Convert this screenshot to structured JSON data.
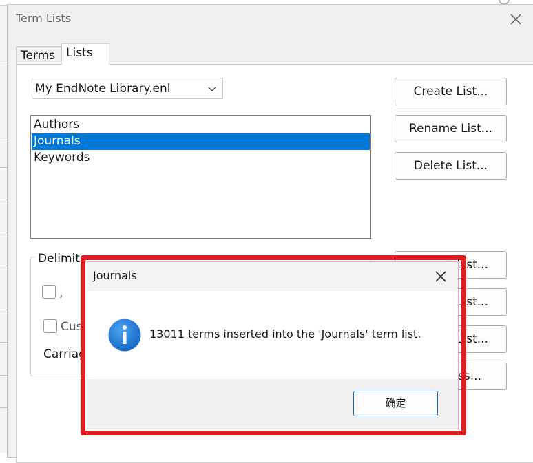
{
  "dialog": {
    "title": "Term Lists",
    "tabs": [
      {
        "label": "Terms",
        "active": false
      },
      {
        "label": "Lists",
        "active": true
      }
    ],
    "library_select": {
      "value": "My EndNote Library.enl"
    },
    "lists": [
      {
        "label": "Authors",
        "selected": false
      },
      {
        "label": "Journals",
        "selected": true
      },
      {
        "label": "Keywords",
        "selected": false
      }
    ],
    "buttons": {
      "create": "Create List...",
      "rename": "Rename List...",
      "delete": "Delete List...",
      "partial_1": "List...",
      "partial_2": "List...",
      "partial_3": "List...",
      "partial_4": "ss..."
    },
    "delimiters": {
      "legend": "Delimite",
      "comma_label": ",",
      "custom_label": "Cus",
      "carriage_label": "Carriag"
    }
  },
  "message_box": {
    "title": "Journals",
    "text": "13011 terms inserted into the 'Journals' term list.",
    "ok_label": "确定",
    "icon": "info-icon"
  },
  "colors": {
    "selection": "#0078d7",
    "highlight_border": "#e31b23",
    "info_icon": "#1f7fd6",
    "ok_border": "#0a67c8"
  }
}
